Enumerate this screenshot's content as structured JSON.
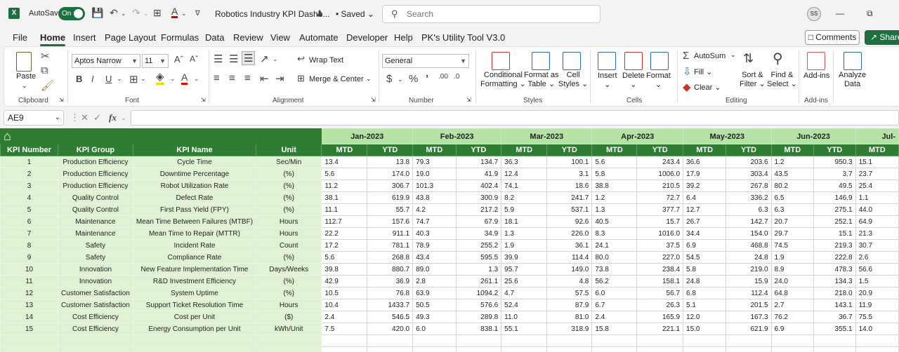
{
  "titlebar": {
    "app_badge": "X",
    "autosave_label": "AutoSave",
    "autosave_state": "On",
    "doc_title": "Robotics Industry KPI Dashb...",
    "saved_label": "• Saved",
    "search_placeholder": "Search",
    "user_initials": "SS"
  },
  "menu": {
    "tabs": [
      "File",
      "Home",
      "Insert",
      "Page Layout",
      "Formulas",
      "Data",
      "Review",
      "View",
      "Automate",
      "Developer",
      "Help",
      "PK's Utility Tool V3.0"
    ],
    "active_tab": "Home",
    "comments_label": "Comments",
    "share_label": "Share"
  },
  "ribbon": {
    "groups": {
      "clipboard": "Clipboard",
      "font": "Font",
      "alignment": "Alignment",
      "number": "Number",
      "styles": "Styles",
      "cells": "Cells",
      "editing": "Editing",
      "addins": "Add-ins"
    },
    "paste": "Paste",
    "font_name": "Aptos Narrow",
    "font_size": "11",
    "wrap_text": "Wrap Text",
    "merge_center": "Merge & Center",
    "number_format": "General",
    "conditional_formatting": [
      "Conditional",
      "Formatting"
    ],
    "format_as_table": [
      "Format as",
      "Table"
    ],
    "cell_styles": [
      "Cell",
      "Styles"
    ],
    "insert": "Insert",
    "delete": "Delete",
    "format": "Format",
    "autosum": "AutoSum",
    "fill": "Fill",
    "clear": "Clear",
    "sort_filter": [
      "Sort &",
      "Filter"
    ],
    "find_select": [
      "Find &",
      "Select"
    ],
    "addins_btn": "Add-ins",
    "analyze_data": [
      "Analyze",
      "Data"
    ]
  },
  "formula_bar": {
    "name_box": "AE9",
    "fx": "fx",
    "formula": ""
  },
  "sheet": {
    "months": [
      "Jan-2023",
      "Feb-2023",
      "Mar-2023",
      "Apr-2023",
      "May-2023",
      "Jun-2023",
      "Jul-"
    ],
    "columns": [
      "KPI Number",
      "KPI Group",
      "KPI Name",
      "Unit"
    ],
    "mtd": "MTD",
    "ytd": "YTD",
    "rows": [
      {
        "n": "1",
        "group": "Production Efficiency",
        "name": "Cycle Time",
        "unit": "Sec/Min",
        "vals": [
          "13.4",
          "13.8",
          "79.3",
          "134.7",
          "36.3",
          "100.1",
          "5.6",
          "243.4",
          "36.6",
          "203.6",
          "1.2",
          "950.3",
          "15.1"
        ]
      },
      {
        "n": "2",
        "group": "Production Efficiency",
        "name": "Downtime Percentage",
        "unit": "(%)",
        "vals": [
          "5.6",
          "174.0",
          "19.0",
          "41.9",
          "12.4",
          "3.1",
          "5.8",
          "1006.0",
          "17.9",
          "303.4",
          "43.5",
          "3.7",
          "23.7"
        ]
      },
      {
        "n": "3",
        "group": "Production Efficiency",
        "name": "Robot Utilization Rate",
        "unit": "(%)",
        "vals": [
          "11.2",
          "306.7",
          "101.3",
          "402.4",
          "74.1",
          "18.6",
          "38.8",
          "210.5",
          "39.2",
          "267.8",
          "80.2",
          "49.5",
          "25.4"
        ]
      },
      {
        "n": "4",
        "group": "Quality Control",
        "name": "Defect Rate",
        "unit": "(%)",
        "vals": [
          "38.1",
          "619.9",
          "43.8",
          "300.9",
          "8.2",
          "241.7",
          "1.2",
          "72.7",
          "6.4",
          "336.2",
          "6.5",
          "146.9",
          "1.1"
        ]
      },
      {
        "n": "5",
        "group": "Quality Control",
        "name": "First Pass Yield (FPY)",
        "unit": "(%)",
        "vals": [
          "11.1",
          "55.7",
          "4.2",
          "217.2",
          "5.9",
          "537.1",
          "1.3",
          "377.7",
          "12.7",
          "6.3",
          "6.3",
          "275.1",
          "44.0"
        ]
      },
      {
        "n": "6",
        "group": "Maintenance",
        "name": "Mean Time Between Failures (MTBF)",
        "unit": "Hours",
        "vals": [
          "112.7",
          "157.6",
          "74.7",
          "67.9",
          "18.1",
          "92.6",
          "40.5",
          "15.7",
          "26.7",
          "142.7",
          "20.7",
          "252.1",
          "64.9"
        ]
      },
      {
        "n": "7",
        "group": "Maintenance",
        "name": "Mean Time to Repair (MTTR)",
        "unit": "Hours",
        "vals": [
          "22.2",
          "911.1",
          "40.3",
          "34.9",
          "1.3",
          "226.0",
          "8.3",
          "1016.0",
          "34.4",
          "154.0",
          "29.7",
          "15.1",
          "21.3"
        ]
      },
      {
        "n": "8",
        "group": "Safety",
        "name": "Incident Rate",
        "unit": "Count",
        "vals": [
          "17.2",
          "781.1",
          "78.9",
          "255.2",
          "1.9",
          "36.1",
          "24.1",
          "37.5",
          "6.9",
          "468.8",
          "74.5",
          "219.3",
          "30.7"
        ]
      },
      {
        "n": "9",
        "group": "Safety",
        "name": "Compliance Rate",
        "unit": "(%)",
        "vals": [
          "5.6",
          "268.8",
          "43.4",
          "595.5",
          "39.9",
          "114.4",
          "80.0",
          "227.0",
          "54.5",
          "24.8",
          "1.9",
          "222.8",
          "2.6"
        ]
      },
      {
        "n": "10",
        "group": "Innovation",
        "name": "New Feature Implementation Time",
        "unit": "Days/Weeks",
        "vals": [
          "39.8",
          "880.7",
          "89.0",
          "1.3",
          "95.7",
          "149.0",
          "73.8",
          "238.4",
          "5.8",
          "219.0",
          "8.9",
          "478.3",
          "56.6"
        ]
      },
      {
        "n": "11",
        "group": "Innovation",
        "name": "R&D Investment Efficiency",
        "unit": "(%)",
        "vals": [
          "42.9",
          "36.9",
          "2.8",
          "261.1",
          "25.6",
          "4.8",
          "56.2",
          "158.1",
          "24.8",
          "15.9",
          "24.0",
          "134.3",
          "1.5"
        ]
      },
      {
        "n": "12",
        "group": "Customer Satisfaction",
        "name": "System Uptime",
        "unit": "(%)",
        "vals": [
          "10.5",
          "76.8",
          "63.9",
          "1094.2",
          "4.7",
          "57.5",
          "6.0",
          "56.7",
          "6.8",
          "112.4",
          "64.8",
          "218.0",
          "20.9"
        ]
      },
      {
        "n": "13",
        "group": "Customer Satisfaction",
        "name": "Support Ticket Resolution Time",
        "unit": "Hours",
        "vals": [
          "10.4",
          "1433.7",
          "50.5",
          "576.6",
          "52.4",
          "87.9",
          "6.7",
          "26.3",
          "5.1",
          "201.5",
          "2.7",
          "143.1",
          "11.9"
        ]
      },
      {
        "n": "14",
        "group": "Cost Efficiency",
        "name": "Cost per Unit",
        "unit": "($)",
        "vals": [
          "2.4",
          "546.5",
          "49.3",
          "289.8",
          "11.0",
          "81.0",
          "2.4",
          "165.9",
          "12.0",
          "167.3",
          "76.2",
          "36.7",
          "75.5"
        ]
      },
      {
        "n": "15",
        "group": "Cost Efficiency",
        "name": "Energy Consumption per Unit",
        "unit": "kWh/Unit",
        "vals": [
          "7.5",
          "420.0",
          "6.0",
          "838.1",
          "55.1",
          "318.9",
          "15.8",
          "221.1",
          "15.0",
          "621.9",
          "6.9",
          "355.1",
          "14.0"
        ]
      }
    ]
  }
}
